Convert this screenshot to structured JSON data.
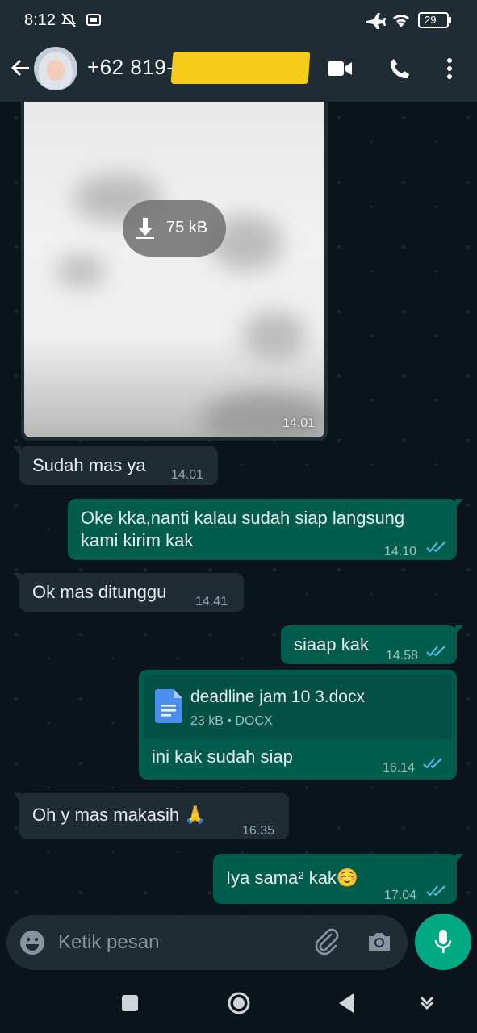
{
  "status_bar": {
    "time": "8:12",
    "battery": "29"
  },
  "header": {
    "contact_name": "+62 819-"
  },
  "image_message": {
    "size_label": "75 kB",
    "time": "14.01"
  },
  "messages": [
    {
      "direction": "in",
      "text": "Sudah mas ya",
      "time": "14.01"
    },
    {
      "direction": "out",
      "text": "Oke kka,nanti kalau sudah siap langsung kami kirim kak",
      "line1": "Oke kka,nanti kalau sudah siap langsung",
      "line2": "kami kirim kak",
      "time": "14.10"
    },
    {
      "direction": "in",
      "text": "Ok mas ditunggu",
      "time": "14.41"
    },
    {
      "direction": "out",
      "text": "siaap kak",
      "time": "14.58"
    },
    {
      "direction": "out",
      "text": "ini kak sudah siap",
      "time": "16.14",
      "document": {
        "name": "deadline jam 10 3.docx",
        "meta": "23 kB • DOCX"
      }
    },
    {
      "direction": "in",
      "text": "Oh y mas makasih 🙏",
      "time": "16.35"
    },
    {
      "direction": "out",
      "text": "Iya sama² kak☺️",
      "time": "17.04"
    }
  ],
  "input": {
    "placeholder": "Ketik pesan"
  },
  "colors": {
    "incoming": "#202c33",
    "outgoing": "#005c4b",
    "accent": "#00a884",
    "read_ticks": "#53bdeb"
  },
  "icons": [
    "back-arrow-icon",
    "video-call-icon",
    "phone-icon",
    "more-vert-icon",
    "download-icon",
    "document-icon",
    "emoji-icon",
    "attach-icon",
    "camera-icon",
    "mic-icon",
    "read-receipt-icon"
  ]
}
